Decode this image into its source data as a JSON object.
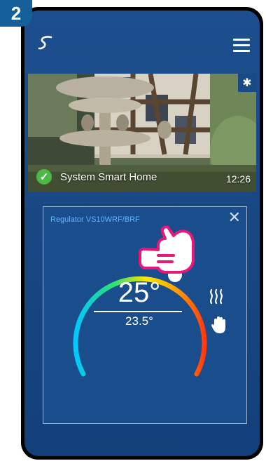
{
  "step_badge": "2",
  "app": {
    "logo_icon": "app-logo-icon",
    "menu_icon": "hamburger-menu-icon"
  },
  "system": {
    "name": "System Smart Home",
    "time": "12:26",
    "status_icon": "check-circle-icon",
    "settings_icon": "gear-icon"
  },
  "regulator": {
    "title": "Regulator VS10WRF/BRF",
    "set_temperature": "25°",
    "room_temperature": "23.5°",
    "mode_icons": [
      "heating-icon",
      "manual-mode-hand-icon"
    ],
    "gradient_colors": [
      "#00c8ff",
      "#2ee070",
      "#ffe600",
      "#ff9a00",
      "#ff3a10"
    ],
    "slider_position_fraction": 0.62
  },
  "colors": {
    "background": "#184782",
    "accent": "#5fb5ff",
    "badge": "#155f9a",
    "pointer": "#e4197a"
  }
}
